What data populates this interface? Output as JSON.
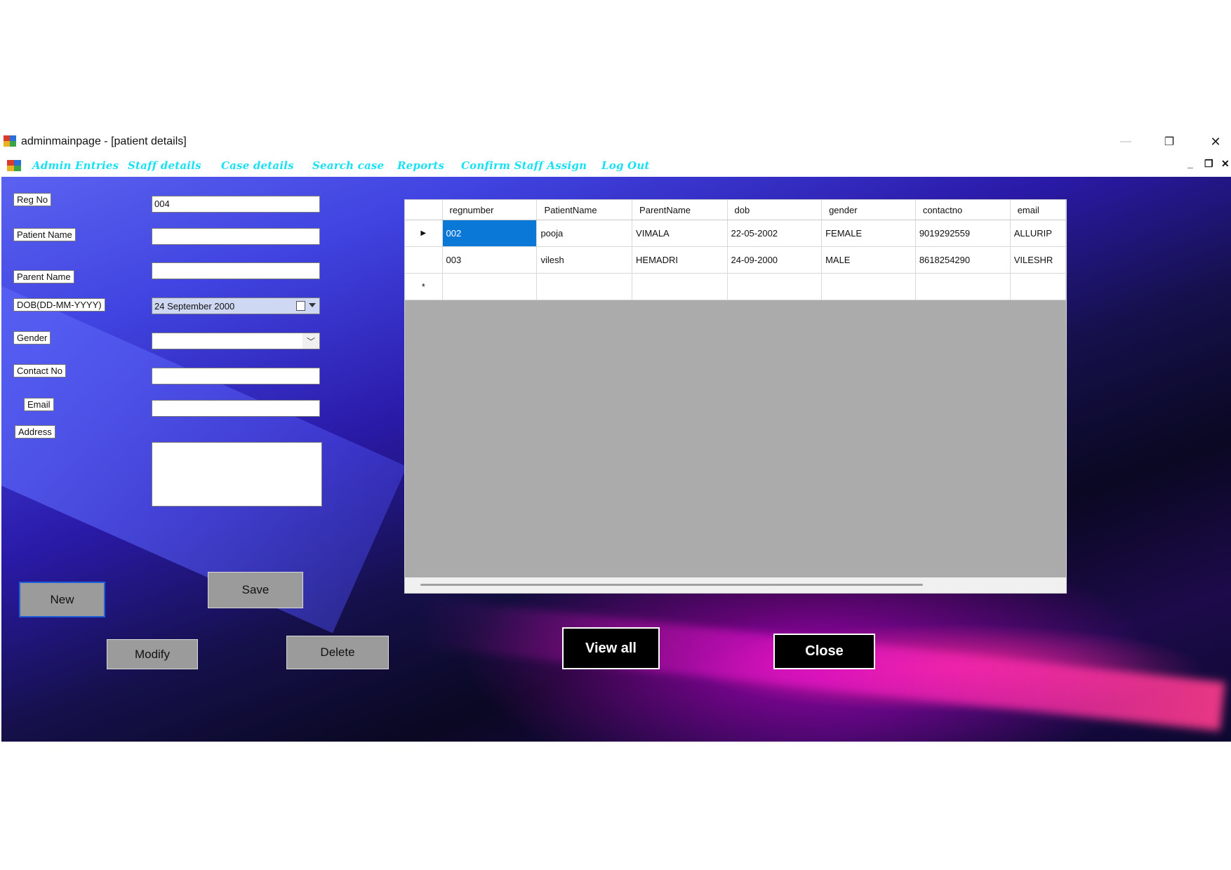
{
  "window": {
    "title": "adminmainpage - [patient details]",
    "controls": {
      "minimize": "—",
      "restore": "❐",
      "close": "✕"
    }
  },
  "menu": {
    "items": [
      {
        "label": "Admin Entries"
      },
      {
        "label": "Staff details"
      },
      {
        "label": "Case details"
      },
      {
        "label": "Search case"
      },
      {
        "label": "Reports"
      },
      {
        "label": "Confirm Staff Assign"
      },
      {
        "label": "Log Out"
      }
    ],
    "accent_color": "#19e0f2"
  },
  "form": {
    "labels": {
      "reg_no": "Reg No",
      "patient_name": "Patient Name",
      "parent_name": "Parent Name",
      "dob": "DOB(DD-MM-YYYY)",
      "gender": "Gender",
      "contact_no": "Contact No",
      "email": "Email",
      "address": "Address"
    },
    "values": {
      "reg_no": "004",
      "patient_name": "",
      "parent_name": "",
      "dob": "24 September 2000",
      "gender": "",
      "contact_no": "",
      "email": "",
      "address": ""
    }
  },
  "buttons": {
    "new": "New",
    "save": "Save",
    "modify": "Modify",
    "delete": "Delete",
    "view_all": "View all",
    "close": "Close"
  },
  "grid": {
    "columns": [
      "regnumber",
      "PatientName",
      "ParentName",
      "dob",
      "gender",
      "contactno",
      "email"
    ],
    "rows": [
      {
        "regnumber": "002",
        "PatientName": "pooja",
        "ParentName": "VIMALA",
        "dob": "22-05-2002",
        "gender": "FEMALE",
        "contactno": "9019292559",
        "email": "ALLURIP"
      },
      {
        "regnumber": "003",
        "PatientName": "vilesh",
        "ParentName": "HEMADRI",
        "dob": "24-09-2000",
        "gender": "MALE",
        "contactno": "8618254290",
        "email": "VILESHR"
      }
    ],
    "current_row_marker": "▶",
    "new_row_marker": "*",
    "selection_color": "#0a78d6"
  }
}
